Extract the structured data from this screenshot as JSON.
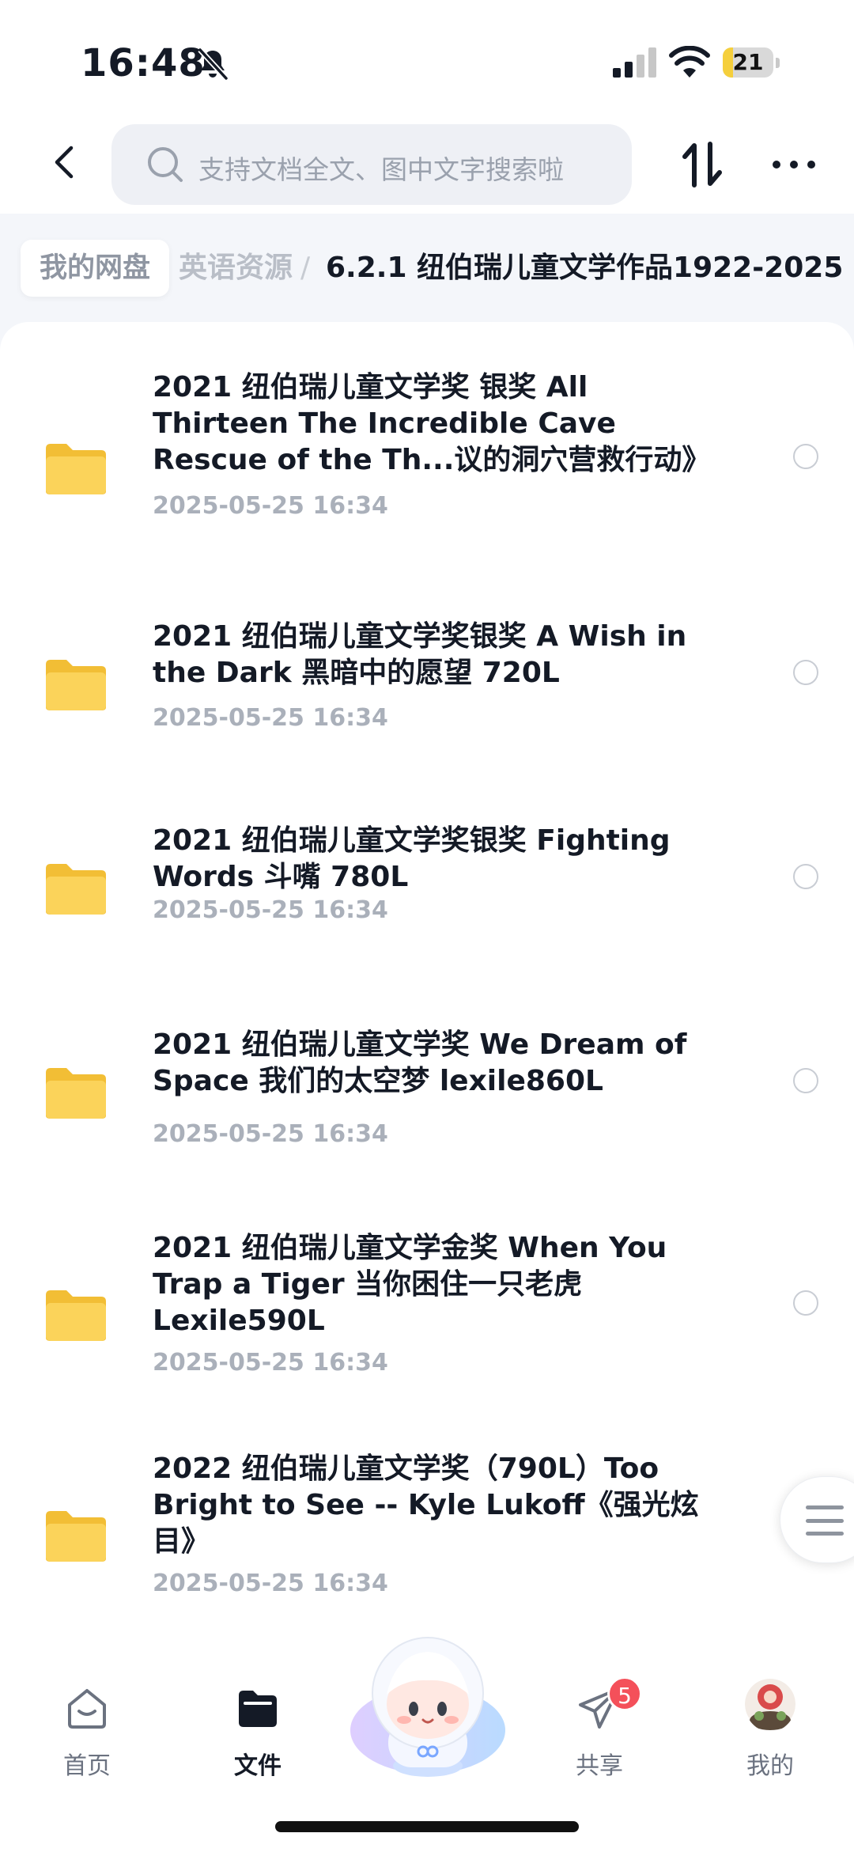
{
  "status_bar": {
    "time": "16:48",
    "battery_level": "21",
    "battery_fraction": 0.21
  },
  "header": {
    "search_placeholder": "支持文档全文、图中文字搜索啦",
    "icons": {
      "back": "chevron-left-icon",
      "search": "search-icon",
      "sort": "sort-arrows-icon",
      "more": "more-dots-icon"
    }
  },
  "breadcrumb": {
    "root": "我的网盘",
    "middle": "英语资源",
    "separator": "/",
    "current": "6.2.1 纽伯瑞儿童文学作品1922-2025"
  },
  "files": [
    {
      "title": "2021 纽伯瑞儿童文学奖 银奖 All Thirteen The Incredible Cave Rescue of the Th...议的洞穴营救行动》",
      "date": "2025-05-25 16:34"
    },
    {
      "title": "2021 纽伯瑞儿童文学奖银奖 A Wish in the Dark 黑暗中的愿望 720L",
      "date": "2025-05-25 16:34"
    },
    {
      "title": "2021 纽伯瑞儿童文学奖银奖 Fighting Words 斗嘴 780L",
      "date": "2025-05-25 16:34"
    },
    {
      "title": "2021 纽伯瑞儿童文学奖 We Dream of Space 我们的太空梦 lexile860L",
      "date": "2025-05-25 16:34"
    },
    {
      "title": "2021 纽伯瑞儿童文学金奖 When You Trap a Tiger 当你困住一只老虎 Lexile590L",
      "date": "2025-05-25 16:34"
    },
    {
      "title": "2022 纽伯瑞儿童文学奖（790L）Too Bright to See -- Kyle Lukoff《强光炫目》",
      "date": "2025-05-25 16:34"
    }
  ],
  "tabs": [
    {
      "label": "首页",
      "icon": "home-icon"
    },
    {
      "label": "文件",
      "icon": "folder-icon",
      "active": true
    },
    {
      "label": "共享",
      "icon": "share-plane-icon",
      "badge": "5"
    },
    {
      "label": "我的",
      "icon": "avatar"
    }
  ],
  "colors": {
    "folder": "#f9cf4f",
    "text_primary": "#141a26",
    "text_secondary": "#aab0ba",
    "badge": "#f4505a",
    "battery": "#f5cf3c"
  }
}
